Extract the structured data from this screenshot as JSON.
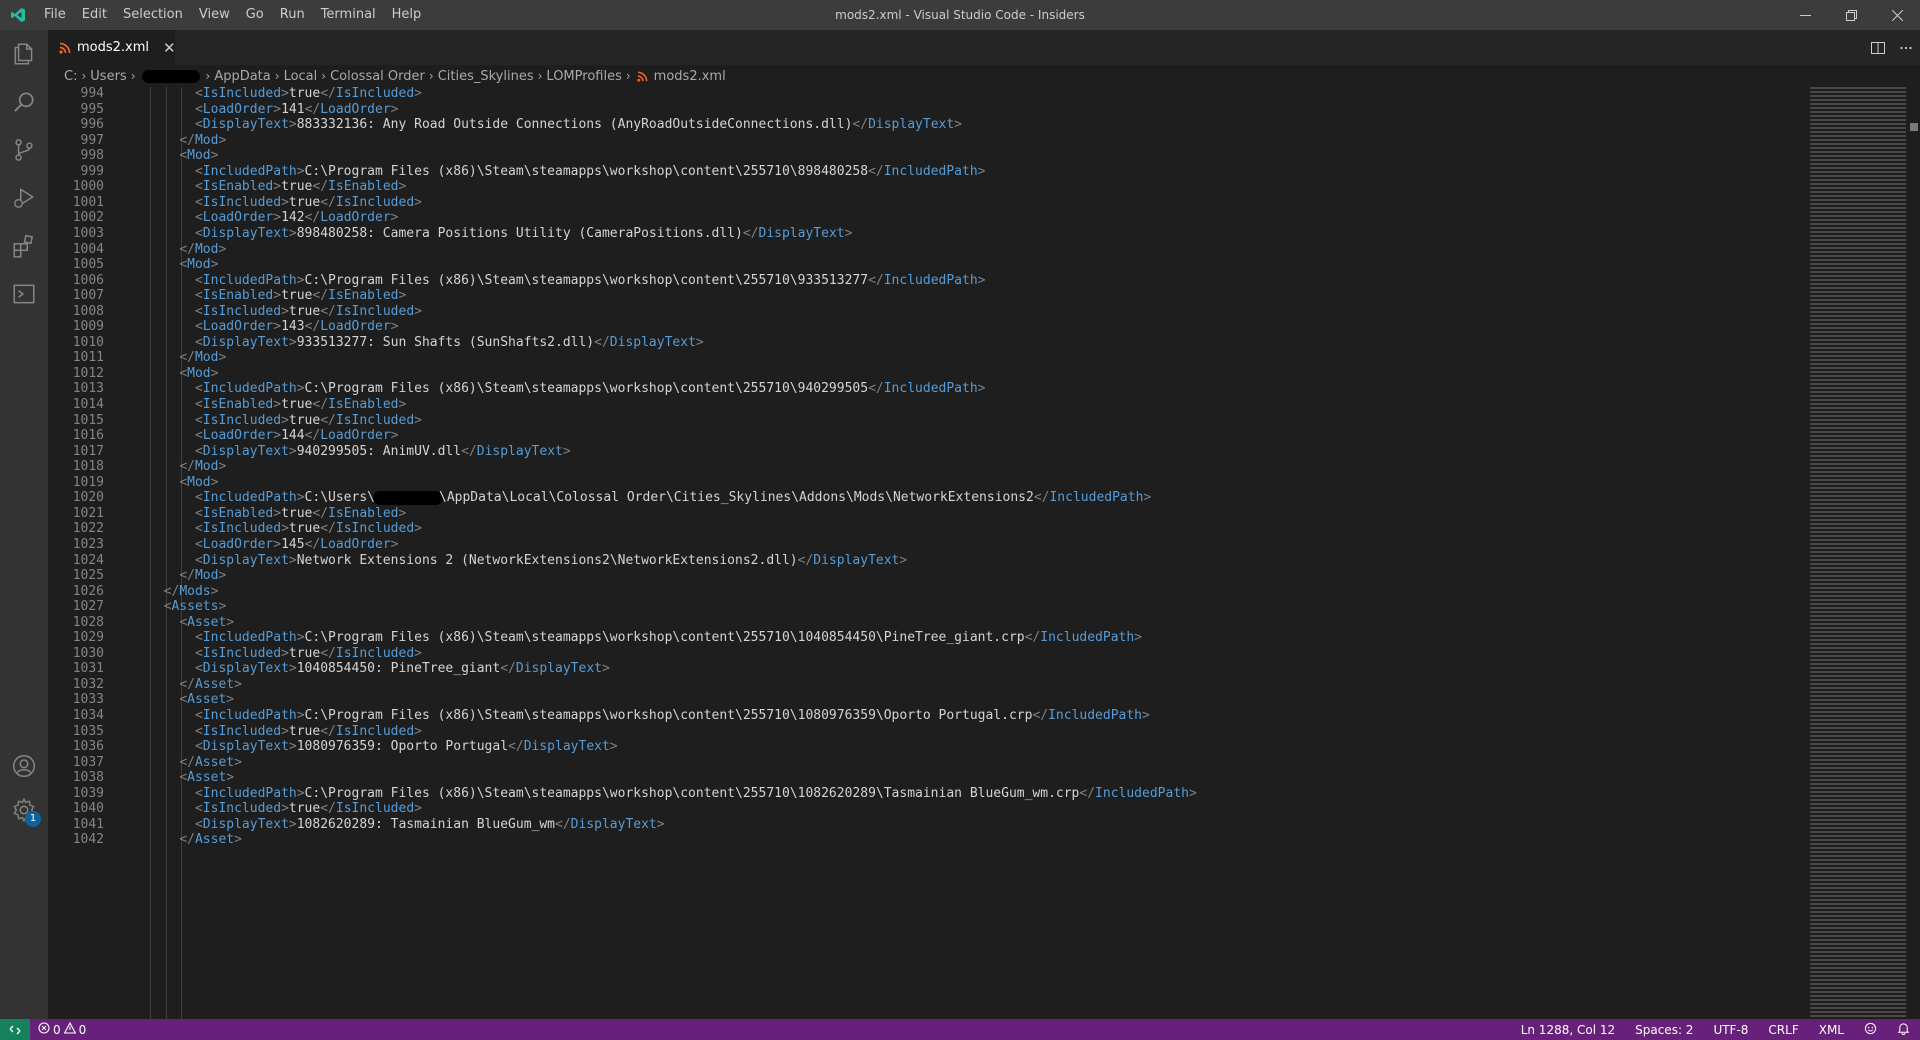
{
  "window": {
    "title": "mods2.xml - Visual Studio Code - Insiders",
    "menu": [
      "File",
      "Edit",
      "Selection",
      "View",
      "Go",
      "Run",
      "Terminal",
      "Help"
    ]
  },
  "tab": {
    "label": "mods2.xml"
  },
  "breadcrumbs": {
    "items": [
      "C:",
      "Users",
      "AppData",
      "Local",
      "Colossal Order",
      "Cities_Skylines",
      "LOMProfiles"
    ],
    "file": "mods2.xml"
  },
  "editor": {
    "partial_top_line": "<IsEnabled>true</IsEnabled>",
    "partial_bottom_line": "</Asset>",
    "lines": [
      {
        "n": "994",
        "t": "      <IsIncluded>true</IsIncluded>"
      },
      {
        "n": "995",
        "t": "      <LoadOrder>141</LoadOrder>"
      },
      {
        "n": "996",
        "t": "      <DisplayText>883332136: Any Road Outside Connections (AnyRoadOutsideConnections.dll)</DisplayText>"
      },
      {
        "n": "997",
        "t": "    </Mod>"
      },
      {
        "n": "998",
        "t": "    <Mod>"
      },
      {
        "n": "999",
        "t": "      <IncludedPath>C:\\Program Files (x86)\\Steam\\steamapps\\workshop\\content\\255710\\898480258</IncludedPath>"
      },
      {
        "n": "1000",
        "t": "      <IsEnabled>true</IsEnabled>"
      },
      {
        "n": "1001",
        "t": "      <IsIncluded>true</IsIncluded>"
      },
      {
        "n": "1002",
        "t": "      <LoadOrder>142</LoadOrder>"
      },
      {
        "n": "1003",
        "t": "      <DisplayText>898480258: Camera Positions Utility (CameraPositions.dll)</DisplayText>"
      },
      {
        "n": "1004",
        "t": "    </Mod>"
      },
      {
        "n": "1005",
        "t": "    <Mod>"
      },
      {
        "n": "1006",
        "t": "      <IncludedPath>C:\\Program Files (x86)\\Steam\\steamapps\\workshop\\content\\255710\\933513277</IncludedPath>"
      },
      {
        "n": "1007",
        "t": "      <IsEnabled>true</IsEnabled>"
      },
      {
        "n": "1008",
        "t": "      <IsIncluded>true</IsIncluded>"
      },
      {
        "n": "1009",
        "t": "      <LoadOrder>143</LoadOrder>"
      },
      {
        "n": "1010",
        "t": "      <DisplayText>933513277: Sun Shafts (SunShafts2.dll)</DisplayText>"
      },
      {
        "n": "1011",
        "t": "    </Mod>"
      },
      {
        "n": "1012",
        "t": "    <Mod>"
      },
      {
        "n": "1013",
        "t": "      <IncludedPath>C:\\Program Files (x86)\\Steam\\steamapps\\workshop\\content\\255710\\940299505</IncludedPath>"
      },
      {
        "n": "1014",
        "t": "      <IsEnabled>true</IsEnabled>"
      },
      {
        "n": "1015",
        "t": "      <IsIncluded>true</IsIncluded>"
      },
      {
        "n": "1016",
        "t": "      <LoadOrder>144</LoadOrder>"
      },
      {
        "n": "1017",
        "t": "      <DisplayText>940299505: AnimUV.dll</DisplayText>"
      },
      {
        "n": "1018",
        "t": "    </Mod>"
      },
      {
        "n": "1019",
        "t": "    <Mod>"
      },
      {
        "n": "1020",
        "t": "      <IncludedPath>C:\\Users\\§\\AppData\\Local\\Colossal Order\\Cities_Skylines\\Addons\\Mods\\NetworkExtensions2</IncludedPath>"
      },
      {
        "n": "1021",
        "t": "      <IsEnabled>true</IsEnabled>"
      },
      {
        "n": "1022",
        "t": "      <IsIncluded>true</IsIncluded>"
      },
      {
        "n": "1023",
        "t": "      <LoadOrder>145</LoadOrder>"
      },
      {
        "n": "1024",
        "t": "      <DisplayText>Network Extensions 2 (NetworkExtensions2\\NetworkExtensions2.dll)</DisplayText>"
      },
      {
        "n": "1025",
        "t": "    </Mod>"
      },
      {
        "n": "1026",
        "t": "  </Mods>"
      },
      {
        "n": "1027",
        "t": "  <Assets>"
      },
      {
        "n": "1028",
        "t": "    <Asset>"
      },
      {
        "n": "1029",
        "t": "      <IncludedPath>C:\\Program Files (x86)\\Steam\\steamapps\\workshop\\content\\255710\\1040854450\\PineTree_giant.crp</IncludedPath>"
      },
      {
        "n": "1030",
        "t": "      <IsIncluded>true</IsIncluded>"
      },
      {
        "n": "1031",
        "t": "      <DisplayText>1040854450: PineTree_giant</DisplayText>"
      },
      {
        "n": "1032",
        "t": "    </Asset>"
      },
      {
        "n": "1033",
        "t": "    <Asset>"
      },
      {
        "n": "1034",
        "t": "      <IncludedPath>C:\\Program Files (x86)\\Steam\\steamapps\\workshop\\content\\255710\\1080976359\\Oporto Portugal.crp</IncludedPath>"
      },
      {
        "n": "1035",
        "t": "      <IsIncluded>true</IsIncluded>"
      },
      {
        "n": "1036",
        "t": "      <DisplayText>1080976359: Oporto Portugal</DisplayText>"
      },
      {
        "n": "1037",
        "t": "    </Asset>"
      },
      {
        "n": "1038",
        "t": "    <Asset>"
      },
      {
        "n": "1039",
        "t": "      <IncludedPath>C:\\Program Files (x86)\\Steam\\steamapps\\workshop\\content\\255710\\1082620289\\Tasmainian BlueGum_wm.crp</IncludedPath>"
      },
      {
        "n": "1040",
        "t": "      <IsIncluded>true</IsIncluded>"
      },
      {
        "n": "1041",
        "t": "      <DisplayText>1082620289: Tasmainian BlueGum_wm</DisplayText>"
      }
    ]
  },
  "statusbar": {
    "errors": "0",
    "warnings": "0",
    "cursor": "Ln 1288, Col 12",
    "indent": "Spaces: 2",
    "encoding": "UTF-8",
    "eol": "CRLF",
    "language": "XML"
  },
  "accounts_badge": "1",
  "icons": {
    "activity": [
      "explorer-icon",
      "search-icon",
      "source-control-icon",
      "run-debug-icon",
      "extensions-icon",
      "remote-explorer-icon",
      "accounts-icon",
      "manage-gear-icon"
    ]
  },
  "colors": {
    "statusbar": "#68217a",
    "tag": "#569cd6",
    "text": "#d4d4d4",
    "xml_file_icon": "#f26522"
  }
}
